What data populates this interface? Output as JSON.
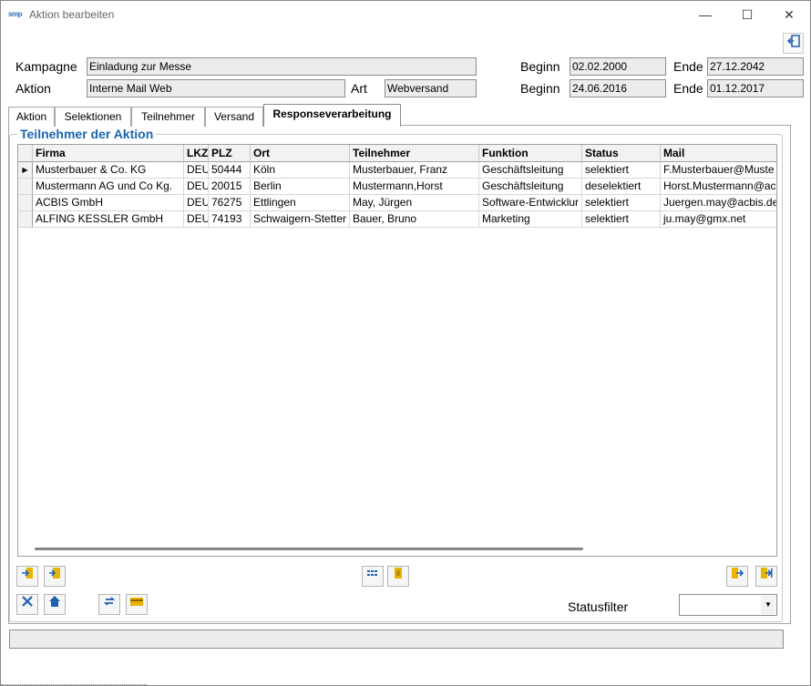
{
  "window": {
    "title": "Aktion bearbeiten",
    "app_icon": "smp"
  },
  "title_controls": {
    "minimize": "—",
    "maximize": "☐",
    "close": "✕"
  },
  "form": {
    "kampagne_label": "Kampagne",
    "kampagne_value": "Einladung zur Messe",
    "aktion_label": "Aktion",
    "aktion_value": "Interne Mail Web",
    "art_label": "Art",
    "art_value": "Webversand",
    "beginn_label": "Beginn",
    "ende_label": "Ende",
    "kampagne_beginn": "02.02.2000",
    "kampagne_ende": "27.12.2042",
    "aktion_beginn": "24.06.2016",
    "aktion_ende": "01.12.2017"
  },
  "tabs": [
    {
      "label": "Aktion"
    },
    {
      "label": "Selektionen"
    },
    {
      "label": "Teilnehmer"
    },
    {
      "label": "Versand"
    },
    {
      "label": "Responseverarbeitung",
      "active": true
    }
  ],
  "group_title": "Teilnehmer der Aktion",
  "table": {
    "columns": [
      "Firma",
      "LKZ",
      "PLZ",
      "Ort",
      "Teilnehmer",
      "Funktion",
      "Status",
      "Mail"
    ],
    "rows": [
      [
        "Musterbauer & Co. KG",
        "DEU",
        "50444",
        "Köln",
        "Musterbauer, Franz",
        "Geschäftsleitung",
        "selektiert",
        "F.Musterbauer@Muste"
      ],
      [
        "Mustermann AG und Co Kg.",
        "DEU",
        "20015",
        "Berlin",
        "Mustermann,Horst",
        "Geschäftsleitung",
        "deselektiert",
        "Horst.Mustermann@ac"
      ],
      [
        "ACBIS GmbH",
        "DEU",
        "76275",
        "Ettlingen",
        "May, Jürgen",
        "Software-Entwicklur",
        "selektiert",
        "Juergen.may@acbis.de"
      ],
      [
        "ALFING KESSLER GmbH",
        "DEU",
        "74193",
        "Schwaigern-Stetter",
        "Bauer, Bruno",
        "Marketing",
        "selektiert",
        "ju.may@gmx.net"
      ]
    ],
    "current_row_marker": "▶"
  },
  "statusfilter": {
    "label": "Statusfilter",
    "value": ""
  },
  "colors": {
    "accent": "#1a66b3",
    "field_bg": "#ececec",
    "header_bg": "#f2f2f2"
  },
  "icons": {
    "exit": "exit-door-icon",
    "toolbar": [
      "import-in-icon",
      "import-doc-icon",
      "grid-columns-icon",
      "document-icon",
      "export-doc-icon",
      "export-exit-icon",
      "delete-x-icon",
      "home-icon",
      "refresh-icon",
      "card-icon"
    ]
  }
}
